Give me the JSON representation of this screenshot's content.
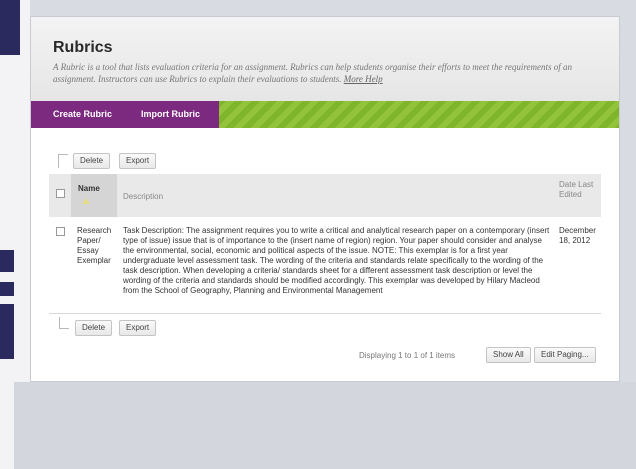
{
  "page": {
    "title": "Rubrics",
    "description": "A Rubric is a tool that lists evaluation criteria for an assignment. Rubrics can help students organise their efforts to meet the requirements of an assignment. Instructors can use Rubrics to explain their evaluations to students.",
    "more_help": "More Help"
  },
  "action_bar": {
    "create_rubric": "Create Rubric",
    "import_rubric": "Import Rubric"
  },
  "top_buttons": {
    "delete": "Delete",
    "export": "Export"
  },
  "bottom_buttons": {
    "delete": "Delete",
    "export": "Export"
  },
  "table": {
    "headers": {
      "name": "Name",
      "description": "Description",
      "date": "Date Last Edited"
    },
    "rows": [
      {
        "name": "Research Paper/ Essay Exemplar",
        "description": "Task Description: The assignment requires you to write a critical and analytical research paper on a contemporary (insert type of issue) issue that is of importance to the (insert name of region) region. Your paper should consider and analyse the environmental, social, economic and political aspects of the issue. NOTE: This exemplar is for a first year undergraduate level assessment task. The wording of the criteria and standards relate specifically to the wording of the task description. When developing a criteria/ standards sheet for a different assessment task description or level the wording of the criteria and standards should be modified accordingly. This exemplar was developed by Hilary Macleod from the School of Geography, Planning and Environmental Management",
        "date": "December 18, 2012"
      }
    ]
  },
  "paging": {
    "status": "Displaying 1 to 1 of 1 items",
    "show_all": "Show All",
    "edit_paging": "Edit Paging..."
  },
  "colors": {
    "accent_purple": "#7b2a80",
    "accent_green": "#8dbd34"
  }
}
